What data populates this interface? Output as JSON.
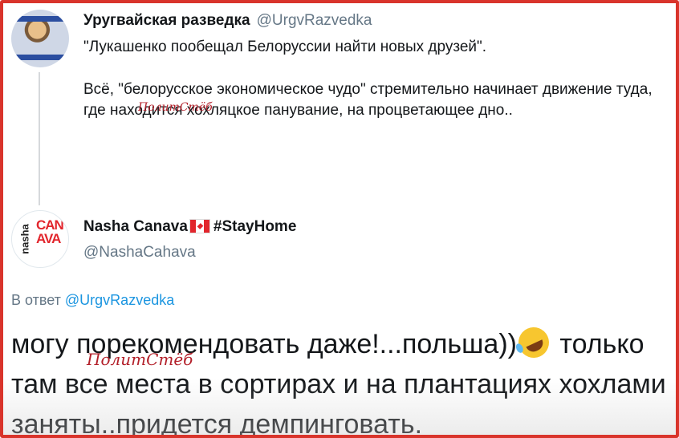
{
  "tweet1": {
    "author_name": "Уругвайская разведка",
    "author_handle": "@UrgvRazvedka",
    "text_line1": "\"Лукашенко пообещал Белоруссии найти новых друзей\".",
    "text_line2": "Всё, \"белорусское экономическое чудо\" стремительно начинает движение туда, где находится хохляцкое панувание, на процветающее дно.."
  },
  "tweet2": {
    "author_name": "Nasha Canava",
    "author_tag": "#StayHome",
    "author_handle": "@NashaCahava",
    "reply_prefix": "В ответ",
    "reply_handle": "@UrgvRazvedka",
    "text_part1": "могу порекомендовать даже!...польша))",
    "text_part2": " только там все места в сортирах и на плантациях хохлами заняты..придется демпинговать."
  },
  "watermark": "ПолитСтёб",
  "avatar2": {
    "vertical_text": "nasha",
    "logo_text": "CANAVA"
  },
  "icons": [
    "canada-flag-icon",
    "rolling-laughing-emoji-icon"
  ],
  "colors": {
    "frame_border": "#d9342b",
    "link": "#1b95e0",
    "muted": "#657786",
    "text": "#14171a",
    "watermark": "#b3202a"
  }
}
